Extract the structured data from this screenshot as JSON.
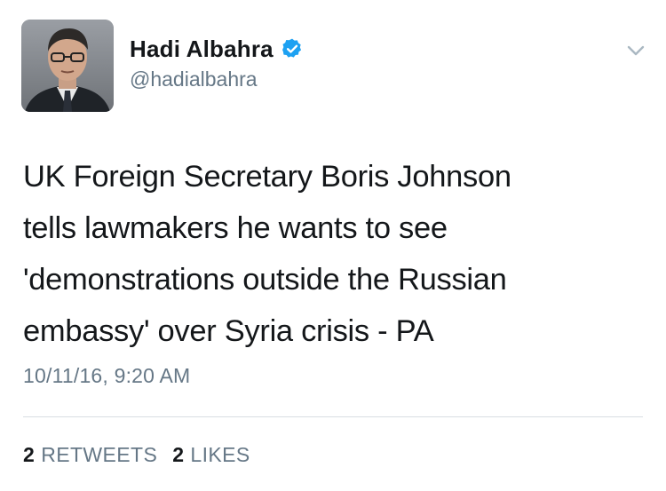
{
  "user": {
    "display_name": "Hadi Albahra",
    "handle": "@hadialbahra",
    "verified": true,
    "avatar_icon": "profile-photo"
  },
  "tweet": {
    "lines": [
      "UK Foreign Secretary Boris Johnson",
      "tells lawmakers he wants to see",
      "'demonstrations outside the Russian",
      "embassy' over Syria crisis - PA"
    ],
    "timestamp": "10/11/16, 9:20 AM"
  },
  "stats": {
    "retweets_count": "2",
    "retweets_label": "RETWEETS",
    "likes_count": "2",
    "likes_label": "LIKES"
  },
  "icons": {
    "verified": "verified-badge-icon",
    "menu": "chevron-down-icon"
  },
  "colors": {
    "verified_blue": "#1da1f2",
    "secondary_text": "#657786",
    "primary_text": "#14171a",
    "divider": "#d9dee3"
  }
}
